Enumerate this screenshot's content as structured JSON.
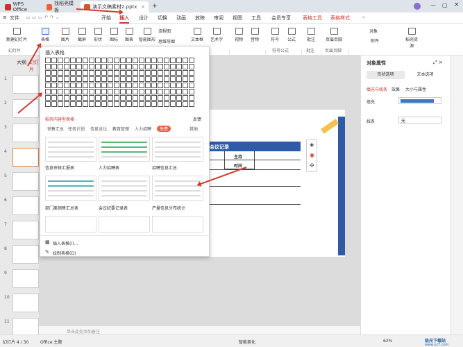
{
  "tabs": [
    {
      "label": "WPS Office"
    },
    {
      "label": "找稻壳模板"
    },
    {
      "label": "演示文稿素材2.pptx"
    }
  ],
  "menu": {
    "file": "文件",
    "items": [
      "开始",
      "插入",
      "设计",
      "切换",
      "动画",
      "放映",
      "审阅",
      "视图",
      "工具",
      "会员专享"
    ],
    "context": [
      "表格工具",
      "表格样式"
    ]
  },
  "ribbon": {
    "items": [
      "新建幻灯片",
      "表格",
      "图片",
      "截屏",
      "形状",
      "图标",
      "图表",
      "智能图形",
      "流程图",
      "思维导图",
      "文本框",
      "艺术字",
      "视频",
      "音频",
      "符号",
      "公式",
      "批注",
      "页眉页脚",
      "对象",
      "附件",
      "稻壳资源"
    ],
    "sections": [
      "幻灯片",
      "符号公式",
      "批注",
      "页眉页脚"
    ]
  },
  "left": {
    "outline": "大纲",
    "slides": "幻灯片",
    "numbers": [
      "1",
      "2",
      "3",
      "4",
      "5",
      "6",
      "7",
      "8",
      "9",
      "10",
      "11"
    ]
  },
  "dropdown": {
    "title": "插入表格",
    "hint": "稻壳内容型表格",
    "feedback": "反馈",
    "categories": [
      "销售汇总",
      "任务计划",
      "信息对比",
      "教育管理",
      "人力招聘",
      "免费",
      "其他"
    ],
    "templates": [
      "信息审核汇报表",
      "人力招聘表",
      "招聘信息汇总",
      "部门离销售汇总表",
      "会议纪要记录表",
      "产量信息分布统计"
    ],
    "insert_table": "插入表格(I)...",
    "draw_table": "绘制表格(D)"
  },
  "slide": {
    "heading": "会议记录",
    "row1": "主持",
    "row2": "时间"
  },
  "rightpanel": {
    "title": "对象属性",
    "tab1": "形状选项",
    "tab2": "文本选项",
    "sub1": "填充与线条",
    "sub2": "效果",
    "sub3": "大小与属性",
    "fill": "填充",
    "line": "线条",
    "line_value": "无"
  },
  "notes": "单击此处添加备注",
  "status": {
    "slide": "幻灯片 4 / 30",
    "theme": "Office 主题",
    "smart": "智能美化",
    "zoom": "62%",
    "watermark": "极光下载站",
    "watermark_url": "www.xz7.com"
  },
  "colors": {
    "accent": "#d0302a",
    "fill_swatch": "#4472c4"
  }
}
